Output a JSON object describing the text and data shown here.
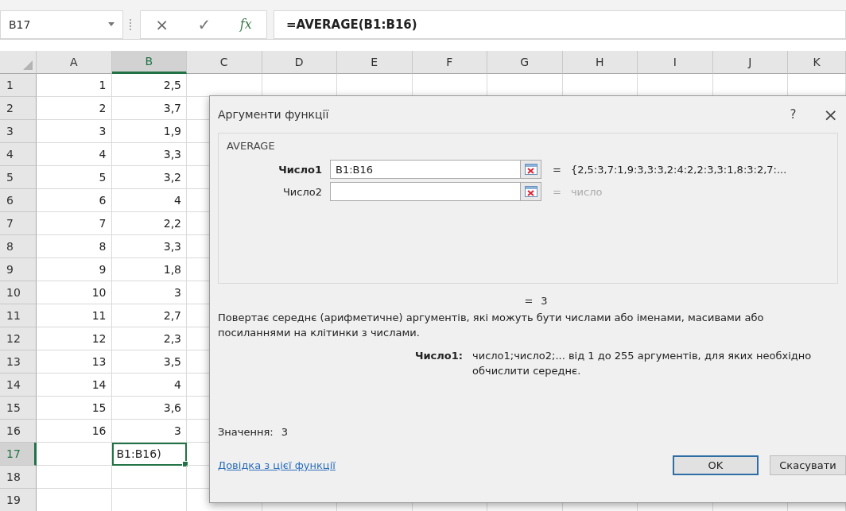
{
  "formula_bar": {
    "name_box": "B17",
    "cancel": "×",
    "enter": "✓",
    "fx": "fx",
    "formula": "=AVERAGE(B1:B16)"
  },
  "columns": [
    {
      "label": "A",
      "selected": false
    },
    {
      "label": "B",
      "selected": true
    },
    {
      "label": "C",
      "selected": false
    },
    {
      "label": "D",
      "selected": false
    },
    {
      "label": "E",
      "selected": false
    },
    {
      "label": "F",
      "selected": false
    },
    {
      "label": "G",
      "selected": false
    },
    {
      "label": "H",
      "selected": false
    },
    {
      "label": "I",
      "selected": false
    },
    {
      "label": "J",
      "selected": false
    },
    {
      "label": "K",
      "selected": false
    }
  ],
  "rows": [
    {
      "number": "1",
      "a": "1",
      "b": "2,5",
      "selected": false
    },
    {
      "number": "2",
      "a": "2",
      "b": "3,7",
      "selected": false
    },
    {
      "number": "3",
      "a": "3",
      "b": "1,9",
      "selected": false
    },
    {
      "number": "4",
      "a": "4",
      "b": "3,3",
      "selected": false
    },
    {
      "number": "5",
      "a": "5",
      "b": "3,2",
      "selected": false
    },
    {
      "number": "6",
      "a": "6",
      "b": "4",
      "selected": false
    },
    {
      "number": "7",
      "a": "7",
      "b": "2,2",
      "selected": false
    },
    {
      "number": "8",
      "a": "8",
      "b": "3,3",
      "selected": false
    },
    {
      "number": "9",
      "a": "9",
      "b": "1,8",
      "selected": false
    },
    {
      "number": "10",
      "a": "10",
      "b": "3",
      "selected": false
    },
    {
      "number": "11",
      "a": "11",
      "b": "2,7",
      "selected": false
    },
    {
      "number": "12",
      "a": "12",
      "b": "2,3",
      "selected": false
    },
    {
      "number": "13",
      "a": "13",
      "b": "3,5",
      "selected": false
    },
    {
      "number": "14",
      "a": "14",
      "b": "4",
      "selected": false
    },
    {
      "number": "15",
      "a": "15",
      "b": "3,6",
      "selected": false
    },
    {
      "number": "16",
      "a": "16",
      "b": "3",
      "selected": false
    },
    {
      "number": "17",
      "a": "",
      "b": "B1:B16)",
      "selected": true
    },
    {
      "number": "18",
      "a": "",
      "b": "",
      "selected": false
    },
    {
      "number": "19",
      "a": "",
      "b": "",
      "selected": false
    }
  ],
  "dialog": {
    "title": "Аргументи функції",
    "help": "?",
    "close": "×",
    "function_name": "AVERAGE",
    "arguments": [
      {
        "label": "Число1",
        "value": "B1:B16",
        "sign": "=",
        "result": "{2,5:3,7:1,9:3,3:3,2:4:2,2:3,3:1,8:3:2,7:...",
        "active": true
      },
      {
        "label": "Число2",
        "sign": "=",
        "result": "число",
        "active": false
      }
    ],
    "formula_result": {
      "sign": "=",
      "value": "3"
    },
    "description": "Повертає середнє (арифметичне) аргументів, які можуть бути числами або іменами, масивами або посиланнями на клітинки з числами.",
    "argument_help": {
      "label": "Число1:",
      "text": "число1;число2;... від 1 до 255 аргументів, для яких необхідно обчислити середнє."
    },
    "value": {
      "label": "Значення:",
      "value": "3"
    },
    "link": "Довідка з цієї функції",
    "buttons": [
      {
        "label": "OK",
        "default": true
      },
      {
        "label": "Скасувати",
        "default": false
      }
    ]
  }
}
